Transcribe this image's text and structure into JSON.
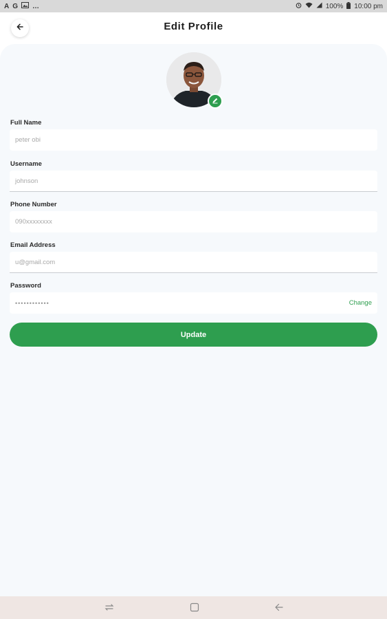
{
  "status_bar": {
    "left_icons": [
      "A",
      "G",
      "image-icon",
      "…"
    ],
    "time": "10:00 pm",
    "battery": "100%"
  },
  "header": {
    "title": "Edit Profile"
  },
  "profile": {
    "avatar_alt": "profile-photo"
  },
  "form": {
    "full_name": {
      "label": "Full Name",
      "value": "peter obi"
    },
    "username": {
      "label": "Username",
      "value": "johnson"
    },
    "phone": {
      "label": "Phone Number",
      "value": "090xxxxxxxx"
    },
    "email": {
      "label": "Email Address",
      "value": "u@gmail.com"
    },
    "password": {
      "label": "Password",
      "value": "••••••••••••",
      "change_label": "Change"
    },
    "update_label": "Update"
  },
  "colors": {
    "accent": "#2e9e4f",
    "panel_bg": "#f6f9fc",
    "nav_bg": "#efe6e3"
  }
}
